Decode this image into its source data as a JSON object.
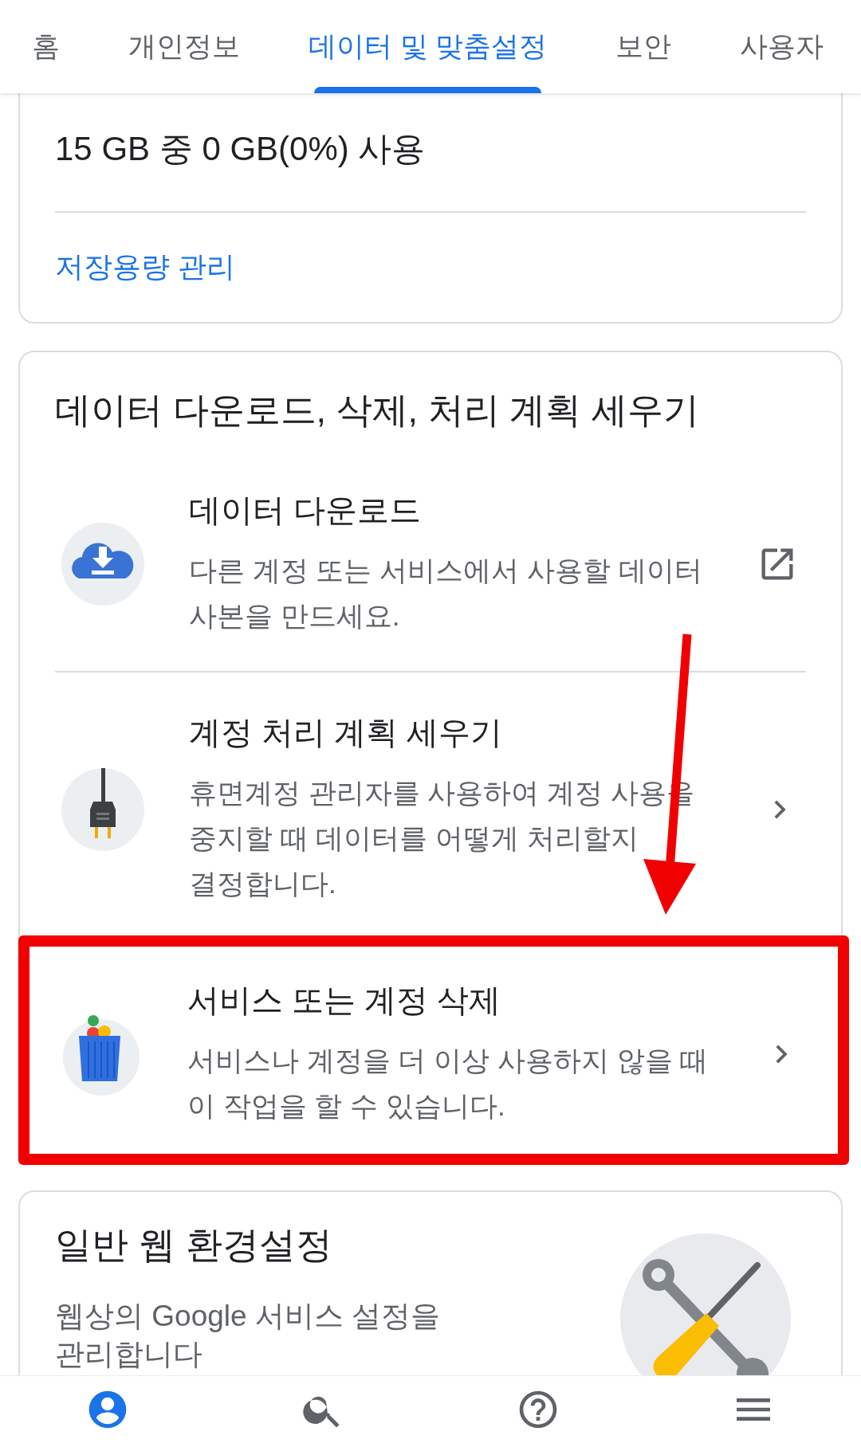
{
  "tabs": [
    {
      "label": "홈",
      "selected": false
    },
    {
      "label": "개인정보",
      "selected": false
    },
    {
      "label": "데이터 및 맞춤설정",
      "selected": true
    },
    {
      "label": "보안",
      "selected": false
    },
    {
      "label": "사용자",
      "selected": false
    }
  ],
  "storage_card": {
    "usage": "15 GB 중 0 GB(0%) 사용",
    "link": "저장용량 관리"
  },
  "data_card": {
    "title": "데이터 다운로드, 삭제, 처리 계획 세우기",
    "items": [
      {
        "kind": "external",
        "title": "데이터 다운로드",
        "description": "다른 계정 또는 서비스에서 사용할 데이터 사본을 만드세요.",
        "highlighted": false
      },
      {
        "kind": "link",
        "title": "계정 처리 계획 세우기",
        "description": "휴면계정 관리자를 사용하여 계정 사용을 중지할 때 데이터를 어떻게 처리할지 결정합니다.",
        "highlighted": false
      },
      {
        "kind": "link",
        "title": "서비스 또는 계정 삭제",
        "description": "서비스나 계정을 더 이상 사용하지 않을 때 이 작업을 할 수 있습니다.",
        "highlighted": true
      }
    ]
  },
  "web_card": {
    "title": "일반 웹 환경설정",
    "description": "웹상의 Google 서비스 설정을 관리합니다"
  },
  "bottom_nav": [
    {
      "kind": "account",
      "selected": true
    },
    {
      "kind": "search",
      "selected": false
    },
    {
      "kind": "help",
      "selected": false
    },
    {
      "kind": "menu",
      "selected": false
    }
  ]
}
